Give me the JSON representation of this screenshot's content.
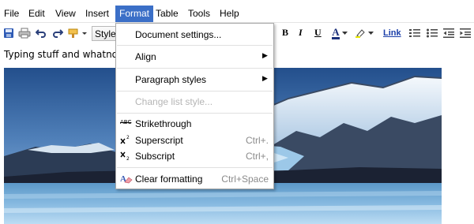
{
  "menubar": {
    "items": [
      "File",
      "Edit",
      "View",
      "Insert",
      "Format",
      "Table",
      "Tools",
      "Help"
    ],
    "active": "Format"
  },
  "toolbar": {
    "style_label": "Style",
    "link_label": "Link",
    "text_color_letter": "A",
    "bold_label": "B",
    "italic_label": "I",
    "underline_label": "U",
    "icons": [
      "save-icon",
      "print-icon",
      "undo-icon",
      "redo-icon",
      "paint-format-icon",
      "text-color-icon",
      "highlight-icon",
      "numbered-list-icon",
      "bulleted-list-icon",
      "decrease-indent-icon",
      "increase-indent-icon"
    ],
    "accent": "#3b6fc7"
  },
  "document": {
    "text": "Typing stuff and whatnot"
  },
  "format_menu": {
    "document_settings": "Document settings...",
    "align": "Align",
    "paragraph_styles": "Paragraph styles",
    "change_list_style": "Change list style...",
    "strikethrough": "Strikethrough",
    "strikethrough_icon_text": "ABC",
    "superscript": "Superscript",
    "superscript_shortcut": "Ctrl+.",
    "subscript": "Subscript",
    "subscript_shortcut": "Ctrl+,",
    "clear_formatting": "Clear formatting",
    "clear_formatting_shortcut": "Ctrl+Space",
    "submenu_arrow": "▶"
  }
}
